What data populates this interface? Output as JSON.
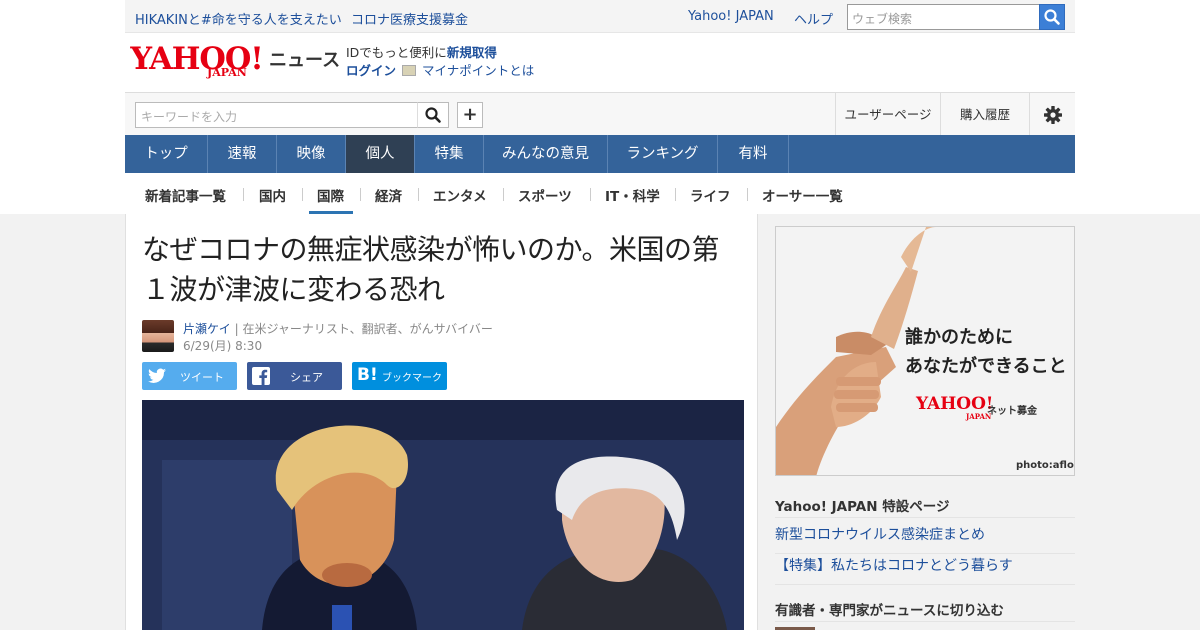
{
  "header": {
    "top_links": [
      "HIKAKINと#命を守る人を支えたい",
      "コロナ医療支援募金"
    ],
    "yahoo_japan": "Yahoo! JAPAN",
    "help": "ヘルプ",
    "web_search_placeholder": "ウェブ検索"
  },
  "logo": {
    "brand": "YAHOO!",
    "brand_sub": "JAPAN",
    "section": "ニュース"
  },
  "account": {
    "id_prefix": "IDでもっと便利に",
    "signup": "新規取得",
    "login": "ログイン",
    "mynapoint": "マイナポイントとは"
  },
  "search": {
    "keyword_placeholder": "キーワードを入力",
    "user_page": "ユーザーページ",
    "purchase_history": "購入履歴"
  },
  "main_nav": {
    "tabs": [
      "トップ",
      "速報",
      "映像",
      "個人",
      "特集",
      "みんなの意見",
      "ランキング",
      "有料"
    ],
    "active": "個人"
  },
  "sub_nav": {
    "items": [
      "新着記事一覧",
      "国内",
      "国際",
      "経済",
      "エンタメ",
      "スポーツ",
      "IT・科学",
      "ライフ",
      "オーサー一覧"
    ],
    "active": "国際"
  },
  "article": {
    "title": "なぜコロナの無症状感染が怖いのか。米国の第１波が津波に変わる恐れ",
    "author_name": "片瀬ケイ",
    "author_desc": " | 在米ジャーナリスト、翻訳者、がんサバイバー",
    "date": "6/29(月) 8:30",
    "share": {
      "tweet": "ツイート",
      "facebook": "シェア",
      "hatena": "ブックマーク"
    }
  },
  "sidebar": {
    "ad": {
      "line1": "誰かのために",
      "line2": "あなたができること",
      "brand": "YAHOO!",
      "brand_sub": "JAPAN",
      "service": "ネット募金",
      "credit": "photo:aflo"
    },
    "special_heading": "Yahoo! JAPAN 特設ページ",
    "special_links": [
      "新型コロナウイルス感染症まとめ",
      "【特集】私たちはコロナとどう暮らす"
    ],
    "experts_heading": "有識者・専門家がニュースに切り込む"
  },
  "colors": {
    "nav_bg": "#34639a",
    "nav_active": "#2f4054",
    "link": "#1d4f9b",
    "yahoo_red": "#e60012",
    "twitter": "#55acee",
    "facebook": "#3b5998",
    "hatena": "#008fde"
  }
}
